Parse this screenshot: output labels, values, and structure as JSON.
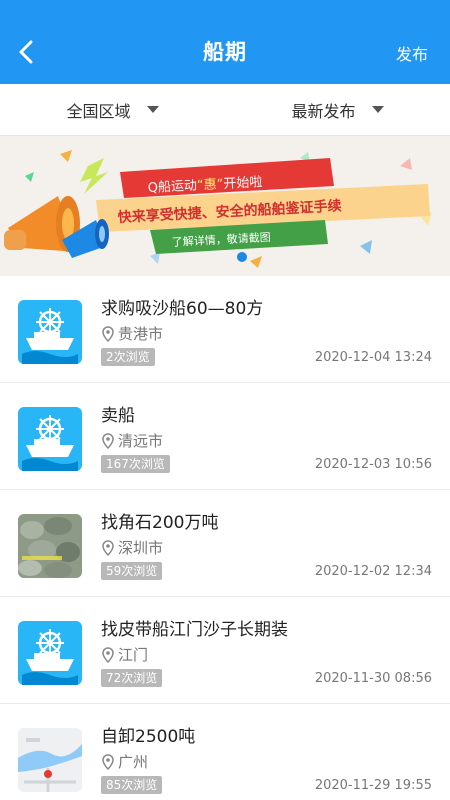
{
  "header": {
    "back_icon": "chevron-left-icon",
    "title": "船期",
    "publish_label": "发布",
    "color": "#2196f3"
  },
  "filters": [
    {
      "label": "全国区域"
    },
    {
      "label": "最新发布"
    }
  ],
  "banner": {
    "line1_prefix": "Q船运动",
    "line1_quote": "“惠”",
    "line1_suffix": "开始啦",
    "line2": "快来享受快捷、安全的船舶鉴证手续",
    "line3": "了解详情，敬请截图",
    "icon": "megaphone-icon"
  },
  "listings": [
    {
      "title": "求购吸沙船60—80方",
      "location": "贵港市",
      "views": "2次浏览",
      "time": "2020-12-04 13:24",
      "thumb": "ship-icon"
    },
    {
      "title": "卖船",
      "location": "清远市",
      "views": "167次浏览",
      "time": "2020-12-03 10:56",
      "thumb": "ship-icon"
    },
    {
      "title": "找角石200万吨",
      "location": "深圳市",
      "views": "59次浏览",
      "time": "2020-12-02 12:34",
      "thumb": "rock-photo"
    },
    {
      "title": "找皮带船江门沙子长期装",
      "location": "江门",
      "views": "72次浏览",
      "time": "2020-11-30 08:56",
      "thumb": "ship-icon"
    },
    {
      "title": "自卸2500吨",
      "location": "广州",
      "views": "85次浏览",
      "time": "2020-11-29 19:55",
      "thumb": "map-photo"
    }
  ]
}
